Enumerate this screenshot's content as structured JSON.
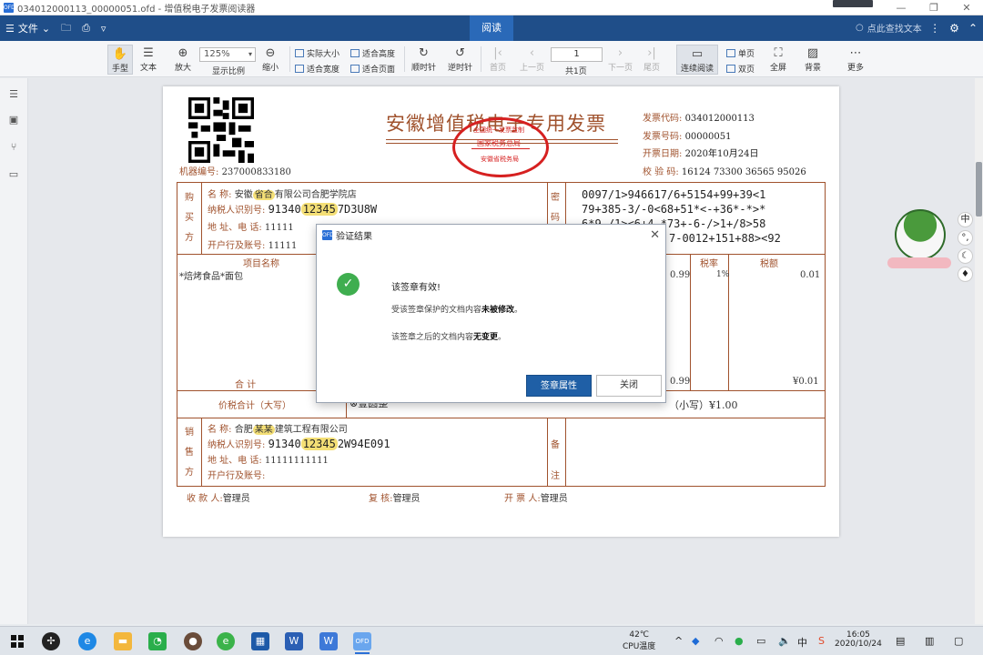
{
  "window": {
    "title": "034012000113_00000051.ofd - 增值税电子发票阅读器",
    "app_icon_text": "OFD",
    "controls": {
      "minimize": "—",
      "maximize": "❐",
      "close": "✕"
    }
  },
  "menubar": {
    "file_label": "文件",
    "active_tab": "阅读",
    "search_label": "点此查找文本"
  },
  "toolbar": {
    "hand": "手型",
    "text": "文本",
    "zoom_in": "放大",
    "zoom_value": "125%",
    "zoom_ratio": "显示比例",
    "zoom_out": "缩小",
    "actual_size": "实际大小",
    "fit_height": "适合高度",
    "fit_width": "适合宽度",
    "fit_page": "适合页面",
    "rotate_cw": "顺时针",
    "rotate_ccw": "逆时针",
    "first_page": "首页",
    "prev_page": "上一页",
    "page_value": "1",
    "page_total": "共1页",
    "next_page": "下一页",
    "last_page": "尾页",
    "continuous": "连续阅读",
    "single": "单页",
    "double": "双页",
    "fullscreen": "全屏",
    "background": "背景",
    "more": "更多"
  },
  "invoice": {
    "title": "安徽增值税电子专用发票",
    "stamp_top": "全国统一发票监制",
    "stamp_mid": "国家税务总局",
    "stamp_bottom": "安徽省税务局",
    "code_label": "发票代码:",
    "code_value": "034012000113",
    "number_label": "发票号码:",
    "number_value": "00000051",
    "date_label": "开票日期:",
    "date_value": "2020年10月24日",
    "check_label": "校 验 码:",
    "check_value": "16124 73300 36565 95026",
    "machine_label": "机器编号:",
    "machine_value": "237000833180",
    "buyer": {
      "side_label": "购买方",
      "name_label": "名      称:",
      "name_value": "安徽",
      "name_masked": "省合",
      "name_rest": "有限公司合肥学院店",
      "tax_label": "纳税人识别号:",
      "tax_value": "91340",
      "tax_masked": "12345",
      "tax_rest": "7D3U8W",
      "addr_label": "地 址、电 话:",
      "addr_value": "11111",
      "bank_label": "开户行及账号:",
      "bank_value": "11111"
    },
    "cipher_label": "密码区",
    "cipher_lines": [
      "0097/1>946617/6+5154+99+39<1",
      "79+385-3/-0<68+51*<-+36*-*>*",
      "6*9-/1><6+4-*73+-6-/>1+/8>58",
      "7-0012+151+88><92"
    ],
    "items_header": {
      "name": "项目名称",
      "tax_rate": "税率",
      "tax": "税额"
    },
    "item": {
      "name": "*焙烤食品*面包",
      "amount": "0.99",
      "rate": "1%",
      "tax": "0.01"
    },
    "total_label": "合      计",
    "total_amount": "0.99",
    "total_tax": "¥0.01",
    "grand_label": "价税合计（大写）",
    "grand_upper": "壹圆整",
    "grand_lower": "（小写）¥1.00",
    "seller": {
      "side_label": "销售方",
      "name_label": "名      称:",
      "name_value": "合肥",
      "name_masked": "某某",
      "name_rest": "建筑工程有限公司",
      "tax_label": "纳税人识别号:",
      "tax_value": "91340",
      "tax_masked": "12345",
      "tax_rest": "2W94E091",
      "addr_label": "地 址、电 话:",
      "addr_value": "11111111111",
      "bank_label": "开户行及账号:",
      "bank_value": ""
    },
    "remark_label": "备注",
    "payee_label": "收 款 人:",
    "payee_value": "管理员",
    "reviewer_label": "复 核:",
    "reviewer_value": "管理员",
    "issuer_label": "开 票 人:",
    "issuer_value": "管理员"
  },
  "dialog": {
    "title": "验证结果",
    "msg_title": "该签章有效!",
    "msg_line1_pre": "受该签章保护的文档内容",
    "msg_line1_bold": "未被修改",
    "msg_line1_post": "。",
    "msg_line2_pre": "该签章之后的文档内容",
    "msg_line2_bold": "无变更",
    "msg_line2_post": "。",
    "primary_button": "签章属性",
    "secondary_button": "关闭"
  },
  "widget_tools": [
    "中",
    "°,",
    "☾",
    "♦"
  ],
  "taskbar": {
    "temp": "42℃",
    "temp_label": "CPU温度",
    "time": "16:05",
    "date": "2020/10/24",
    "ime": "中"
  }
}
